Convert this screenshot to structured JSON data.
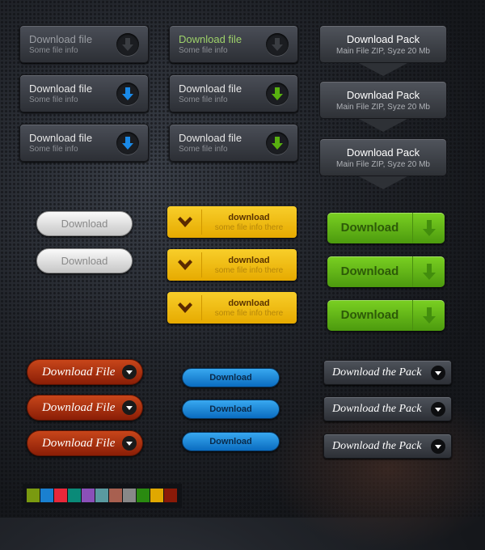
{
  "file_buttons": [
    {
      "title": "Download file",
      "info": "Some file info",
      "style": "dim",
      "arrow": "#3a3d42"
    },
    {
      "title": "Download file",
      "info": "Some file info",
      "style": "green",
      "arrow": "#3a3d42"
    },
    {
      "title": "Download file",
      "info": "Some file info",
      "style": "",
      "arrow": "#1a8ae8"
    },
    {
      "title": "Download file",
      "info": "Some file info",
      "style": "",
      "arrow": "#58b010"
    },
    {
      "title": "Download file",
      "info": "Some file info",
      "style": "",
      "arrow": "#1a8ae8"
    },
    {
      "title": "Download file",
      "info": "Some file info",
      "style": "",
      "arrow": "#58b010"
    }
  ],
  "pack_buttons": [
    {
      "title": "Download Pack",
      "info": "Main File ZIP, Syze 20 Mb"
    },
    {
      "title": "Download Pack",
      "info": "Main File ZIP, Syze 20 Mb"
    },
    {
      "title": "Download Pack",
      "info": "Main File ZIP, Syze 20 Mb"
    }
  ],
  "silver_buttons": [
    "Download",
    "Download"
  ],
  "yellow_buttons": [
    {
      "title": "download",
      "info": "some file info there"
    },
    {
      "title": "download",
      "info": "some file info there"
    },
    {
      "title": "download",
      "info": "some file info there"
    }
  ],
  "green_buttons": [
    "Download",
    "Download",
    "Download"
  ],
  "red_buttons": [
    "Download File",
    "Download File",
    "Download File"
  ],
  "blue_buttons": [
    "Download",
    "Download",
    "Download"
  ],
  "dark_pack_buttons": [
    "Download the Pack",
    "Download the Pack",
    "Download the Pack"
  ],
  "color_swatches": [
    "#7a9a10",
    "#1a80d0",
    "#e8283a",
    "#0a8a78",
    "#8a50b8",
    "#5a9aa0",
    "#a86050",
    "#888888",
    "#2a8a10",
    "#e0a800",
    "#8a1a08"
  ]
}
